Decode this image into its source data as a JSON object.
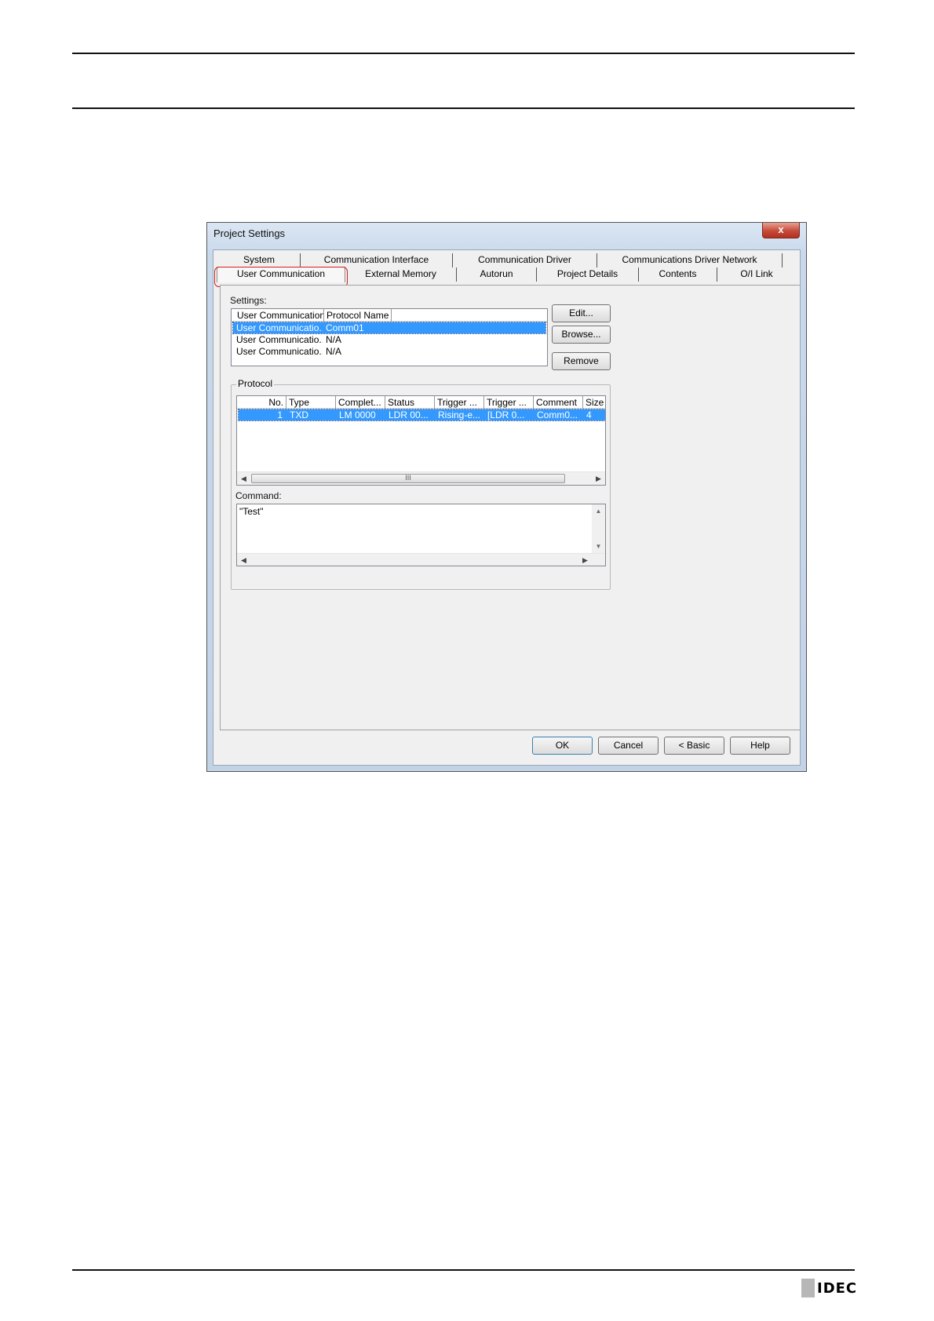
{
  "dialog": {
    "title": "Project Settings",
    "close_glyph": "x",
    "tabs_row1": [
      "System",
      "Communication Interface",
      "Communication Driver",
      "Communications Driver Network"
    ],
    "tabs_row2": [
      "User Communication",
      "External Memory",
      "Autorun",
      "Project Details",
      "Contents",
      "O/I Link"
    ],
    "active_tab": "User Communication",
    "highlight_color": "#d32020"
  },
  "settings": {
    "label": "Settings:",
    "columns": [
      "User Communication",
      "Protocol Name"
    ],
    "rows": [
      {
        "name": "User Communicatio...",
        "protocol": "Comm01",
        "selected": true
      },
      {
        "name": "User Communicatio...",
        "protocol": "N/A",
        "selected": false
      },
      {
        "name": "User Communicatio...",
        "protocol": "N/A",
        "selected": false
      }
    ],
    "buttons": {
      "edit": "Edit...",
      "browse": "Browse...",
      "remove": "Remove"
    }
  },
  "protocol": {
    "label": "Protocol",
    "columns": [
      "No.",
      "Type",
      "Complet...",
      "Status",
      "Trigger ...",
      "Trigger ...",
      "Comment",
      "Size"
    ],
    "rows": [
      [
        "1",
        "TXD",
        "LM 0000",
        "LDR 00...",
        "Rising-e...",
        "[LDR 0...",
        "Comm0...",
        "4"
      ]
    ],
    "scroll_grip": "III"
  },
  "command": {
    "label": "Command:",
    "value": "\"Test\""
  },
  "footer_buttons": {
    "ok": "OK",
    "cancel": "Cancel",
    "basic": "< Basic",
    "help": "Help"
  },
  "brand": {
    "logo_text": "IDEC"
  }
}
